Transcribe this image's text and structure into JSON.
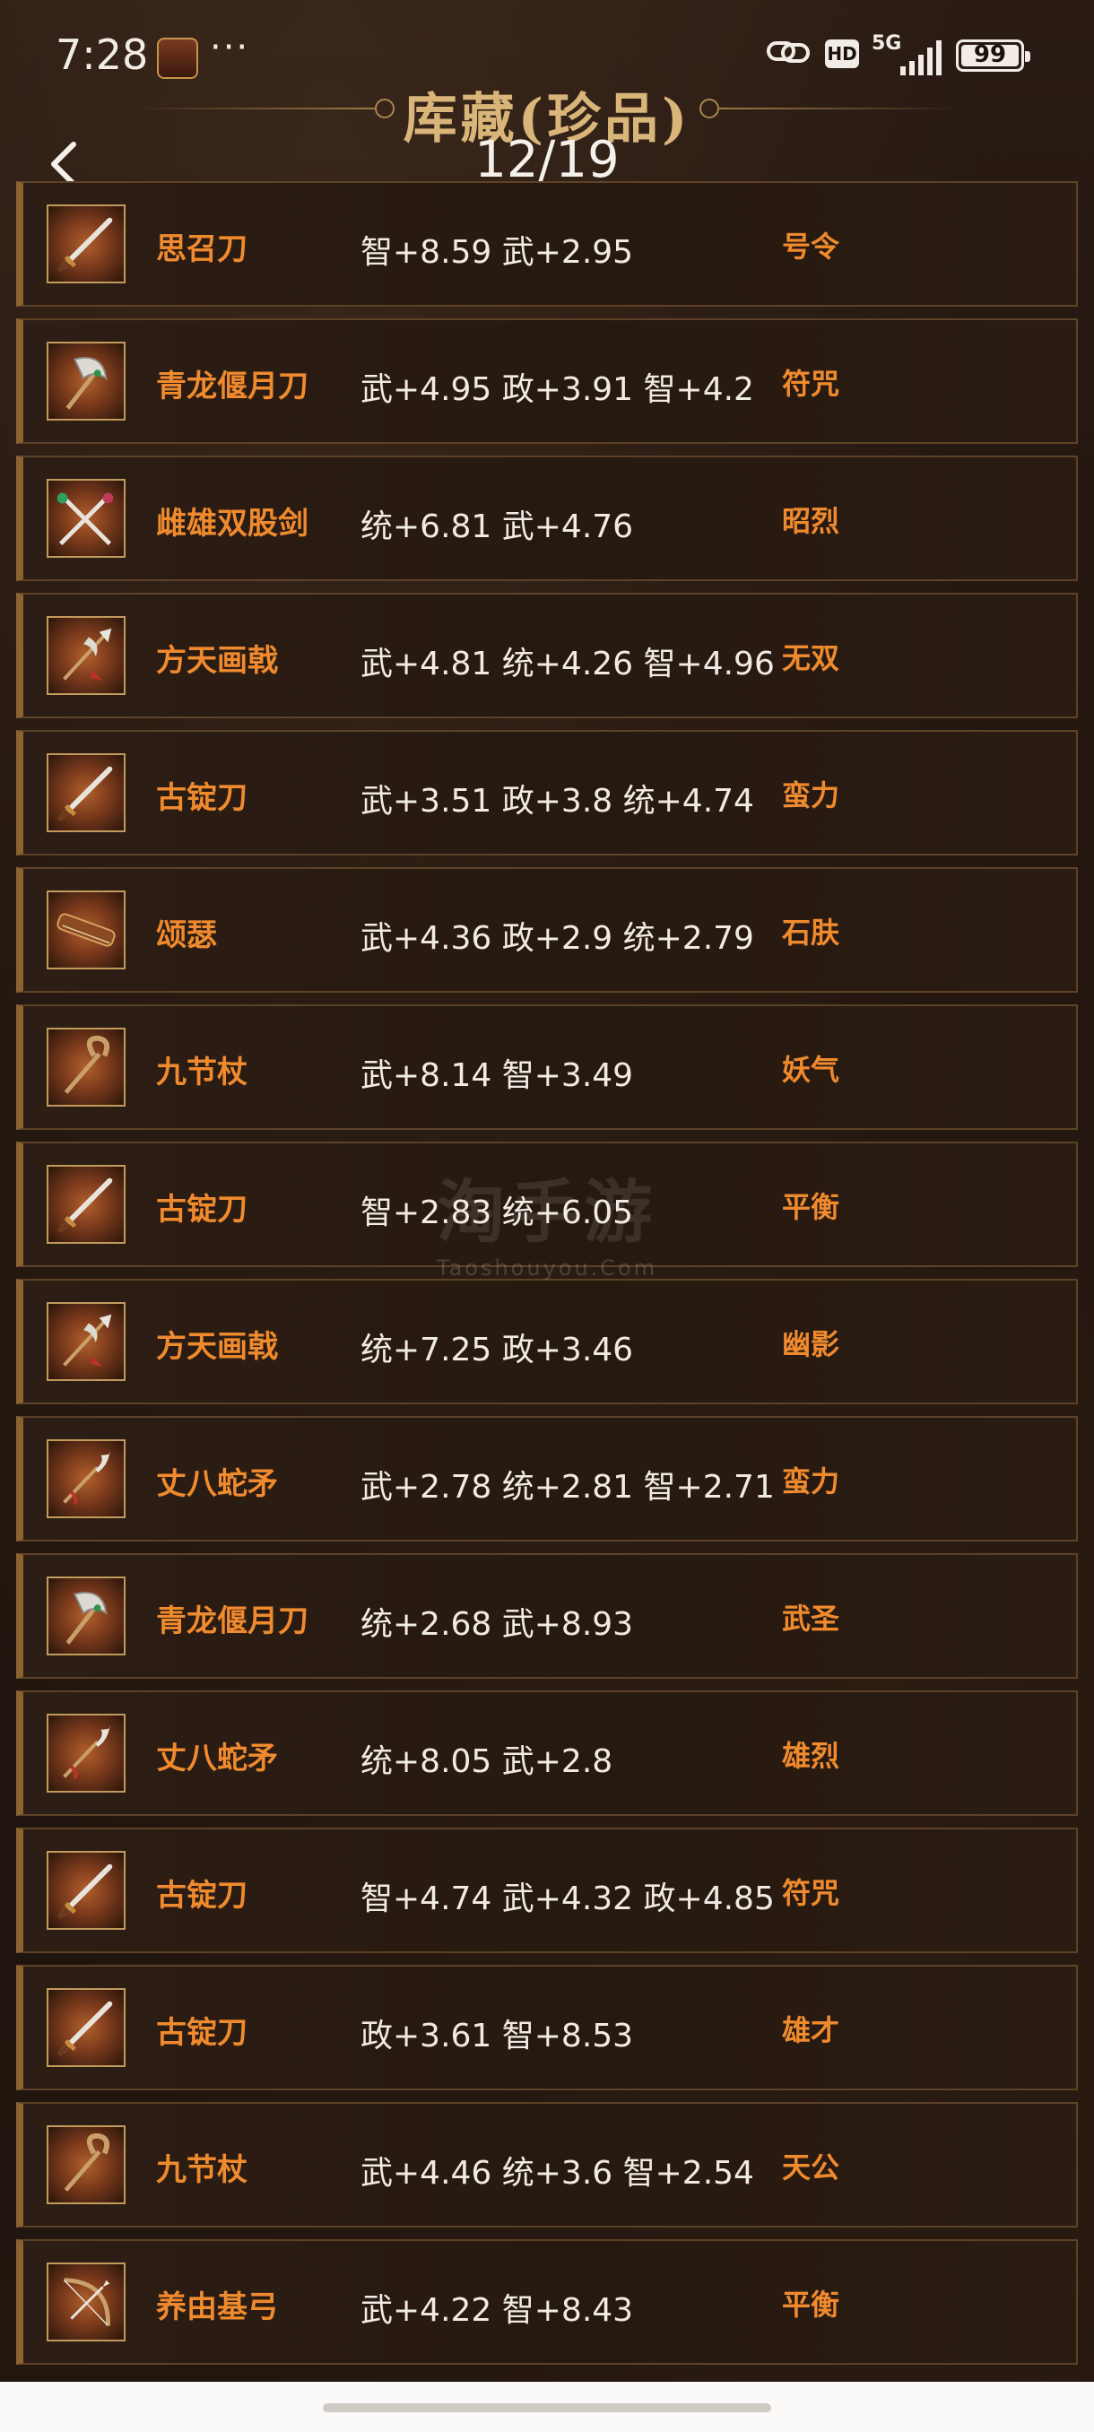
{
  "status_bar": {
    "time": "7:28",
    "dots": "···",
    "hd": "HD",
    "network": "5G",
    "battery": "99"
  },
  "header": {
    "title": "库藏(珍品)",
    "page_indicator": "12/19"
  },
  "items": [
    {
      "name": "思召刀",
      "stats": "智+8.59 武+2.95",
      "skill": "号令",
      "icon": "sword-icon"
    },
    {
      "name": "青龙偃月刀",
      "stats": "武+4.95 政+3.91 智+4.2",
      "skill": "符咒",
      "icon": "glaive-icon"
    },
    {
      "name": "雌雄双股剑",
      "stats": "统+6.81 武+4.76",
      "skill": "昭烈",
      "icon": "twin-swords-icon"
    },
    {
      "name": "方天画戟",
      "stats": "武+4.81 统+4.26 智+4.96",
      "skill": "无双",
      "icon": "halberd-icon"
    },
    {
      "name": "古锭刀",
      "stats": "武+3.51 政+3.8 统+4.74",
      "skill": "蛮力",
      "icon": "sword-icon"
    },
    {
      "name": "颂瑟",
      "stats": "武+4.36 政+2.9 统+2.79",
      "skill": "石肤",
      "icon": "zither-icon"
    },
    {
      "name": "九节杖",
      "stats": "武+8.14 智+3.49",
      "skill": "妖气",
      "icon": "staff-icon"
    },
    {
      "name": "古锭刀",
      "stats": "智+2.83 统+6.05",
      "skill": "平衡",
      "icon": "sword-icon"
    },
    {
      "name": "方天画戟",
      "stats": "统+7.25 政+3.46",
      "skill": "幽影",
      "icon": "halberd-icon"
    },
    {
      "name": "丈八蛇矛",
      "stats": "武+2.78 统+2.81 智+2.71",
      "skill": "蛮力",
      "icon": "serpent-spear-icon"
    },
    {
      "name": "青龙偃月刀",
      "stats": "统+2.68 武+8.93",
      "skill": "武圣",
      "icon": "glaive-icon"
    },
    {
      "name": "丈八蛇矛",
      "stats": "统+8.05 武+2.8",
      "skill": "雄烈",
      "icon": "serpent-spear-icon"
    },
    {
      "name": "古锭刀",
      "stats": "智+4.74 武+4.32 政+4.85",
      "skill": "符咒",
      "icon": "sword-icon"
    },
    {
      "name": "古锭刀",
      "stats": "政+3.61 智+8.53",
      "skill": "雄才",
      "icon": "sword-icon"
    },
    {
      "name": "九节杖",
      "stats": "武+4.46 统+3.6 智+2.54",
      "skill": "天公",
      "icon": "staff-icon"
    },
    {
      "name": "养由基弓",
      "stats": "武+4.22 智+8.43",
      "skill": "平衡",
      "icon": "bow-icon"
    }
  ],
  "watermark": {
    "main": "淘手游",
    "sub": "Taoshouyou.Com"
  },
  "colors": {
    "name": "#f08a2e",
    "stats": "#f0ebe4",
    "title": "#d9b57a",
    "row_border": "#5e4226"
  }
}
